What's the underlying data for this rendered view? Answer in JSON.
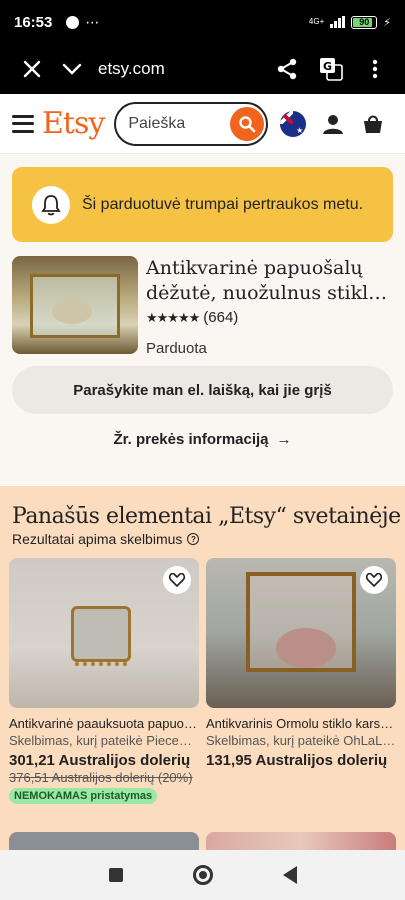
{
  "status_bar": {
    "time": "16:53",
    "network": "4G+",
    "battery": "90",
    "battery_level": 0.9,
    "more": "⋯"
  },
  "browser": {
    "url": "etsy.com",
    "icons": [
      "close-icon",
      "chevron-down-icon",
      "share-icon",
      "translate-icon",
      "more-vert-icon"
    ]
  },
  "header": {
    "logo": "Etsy",
    "search_placeholder": "Paieška",
    "icons": [
      "menu-icon",
      "search-icon",
      "flag-icon",
      "user-icon",
      "cart-icon"
    ]
  },
  "banner": {
    "text": "Ši parduotuvė trumpai pertraukos metu.",
    "icon": "bell-icon"
  },
  "product": {
    "title_line1": "Antikvarinė papuošalų",
    "title_line2": "dėžutė, nuožulnus stiklas, auksinis",
    "stars": "★★★★★",
    "review_count": "(664)",
    "status": "Parduota"
  },
  "notify_button": "Parašykite man el. laišką, kai jie grįš",
  "details_link": "Žr. prekės informaciją",
  "similar": {
    "title": "Panašūs elementai „Etsy“ svetainėje",
    "subtitle": "Rezultatai apima skelbimus",
    "items": [
      {
        "title": "Antikvarinė paauksuota papuošalų dėžutė",
        "seller": "Skelbimas, kurį pateikė PieceOfHistory",
        "price": "301,21 Australijos dolerių",
        "old_price": "376,51 Australijos dolerių (20%)",
        "badge": "NEMOKAMAS pristatymas"
      },
      {
        "title": "Antikvarinis Ormolu stiklo karstelis",
        "seller": "Skelbimas, kurį pateikė OhLaLaVintage",
        "price": "131,95 Australijos dolerių"
      }
    ]
  },
  "colors": {
    "brand": "#f1641e",
    "banner": "#f6c243",
    "similar_bg": "#fbdcbf",
    "badge": "#9be7a4"
  }
}
